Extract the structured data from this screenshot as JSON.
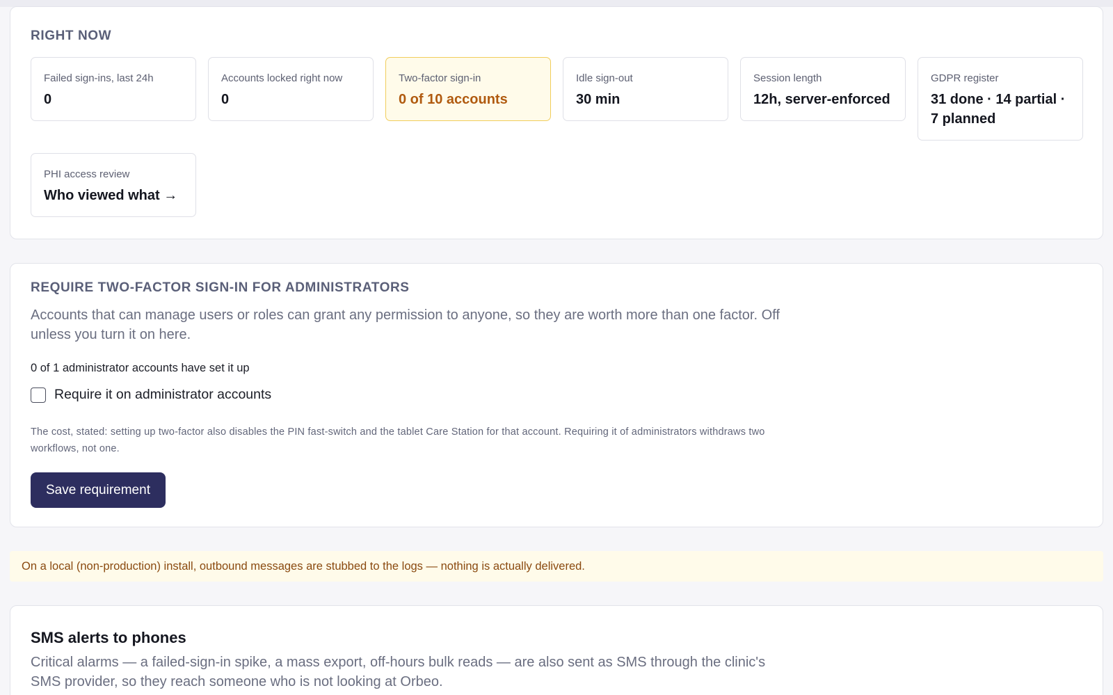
{
  "right_now": {
    "heading": "RIGHT NOW",
    "tiles": [
      {
        "label": "Failed sign-ins, last 24h",
        "value": "0"
      },
      {
        "label": "Accounts locked right now",
        "value": "0"
      },
      {
        "label": "Two-factor sign-in",
        "value": "0 of 10 accounts"
      },
      {
        "label": "Idle sign-out",
        "value": "30 min"
      },
      {
        "label": "Session length",
        "value": "12h, server-enforced"
      },
      {
        "label": "GDPR register",
        "value": "31 done · 14 partial · 7 planned"
      },
      {
        "label": "PHI access review",
        "value": "Who viewed what →"
      }
    ]
  },
  "two_factor": {
    "heading": "REQUIRE TWO-FACTOR SIGN-IN FOR ADMINISTRATORS",
    "description": "Accounts that can manage users or roles can grant any permission to anyone, so they are worth more than one factor. Off unless you turn it on here.",
    "status": "0 of 1 administrator accounts have set it up",
    "checkbox_label": "Require it on administrator accounts",
    "checkbox_checked": false,
    "fine_print": "The cost, stated: setting up two-factor also disables the PIN fast-switch and the tablet Care Station for that account. Requiring it of administrators withdraws two workflows, not one.",
    "save_label": "Save requirement"
  },
  "notice": {
    "text": "On a local (non-production) install, outbound messages are stubbed to the logs — nothing is actually delivered."
  },
  "sms": {
    "title": "SMS alerts to phones",
    "description": "Critical alarms — a failed-sign-in spike, a mass export, off-hours bulk reads — are also sent as SMS through the clinic's SMS provider, so they reach someone who is not looking at Orbeo."
  },
  "colors": {
    "accent": "#2d2e5f",
    "highlight_bg": "#fffbea",
    "highlight_border": "#f1cd5b",
    "warning_text": "#b05a0f"
  }
}
